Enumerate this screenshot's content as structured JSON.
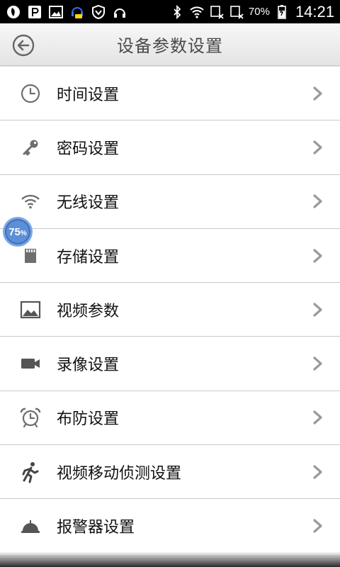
{
  "status_bar": {
    "battery": "70%",
    "time": "14:21",
    "left_icons": [
      "app-icon",
      "parking-icon",
      "image-icon",
      "headset-chat-icon",
      "shield-icon",
      "headphones-icon"
    ],
    "right_icons": [
      "bluetooth-icon",
      "wifi-icon",
      "signal-off-icon",
      "signal-off-icon",
      "battery-charging-icon"
    ]
  },
  "header": {
    "title": "设备参数设置",
    "back_icon": "back-arrow-icon"
  },
  "items": [
    {
      "label": "时间设置",
      "icon": "clock-icon"
    },
    {
      "label": "密码设置",
      "icon": "key-icon"
    },
    {
      "label": "无线设置",
      "icon": "wifi-icon"
    },
    {
      "label": "存储设置",
      "icon": "sd-card-icon"
    },
    {
      "label": "视频参数",
      "icon": "picture-icon"
    },
    {
      "label": "录像设置",
      "icon": "video-camera-icon"
    },
    {
      "label": "布防设置",
      "icon": "alarm-clock-icon"
    },
    {
      "label": "视频移动侦测设置",
      "icon": "running-man-icon"
    },
    {
      "label": "报警器设置",
      "icon": "service-bell-icon"
    }
  ],
  "float_badge": {
    "value": "75",
    "unit": "%"
  },
  "colors": {
    "status_bar": "#000000",
    "header_text": "#4a4a4a",
    "icon_gray": "#6e6e6e",
    "chevron_gray": "#9a9a9a",
    "divider": "#c9c9c9",
    "badge": "#5b8fd6"
  }
}
